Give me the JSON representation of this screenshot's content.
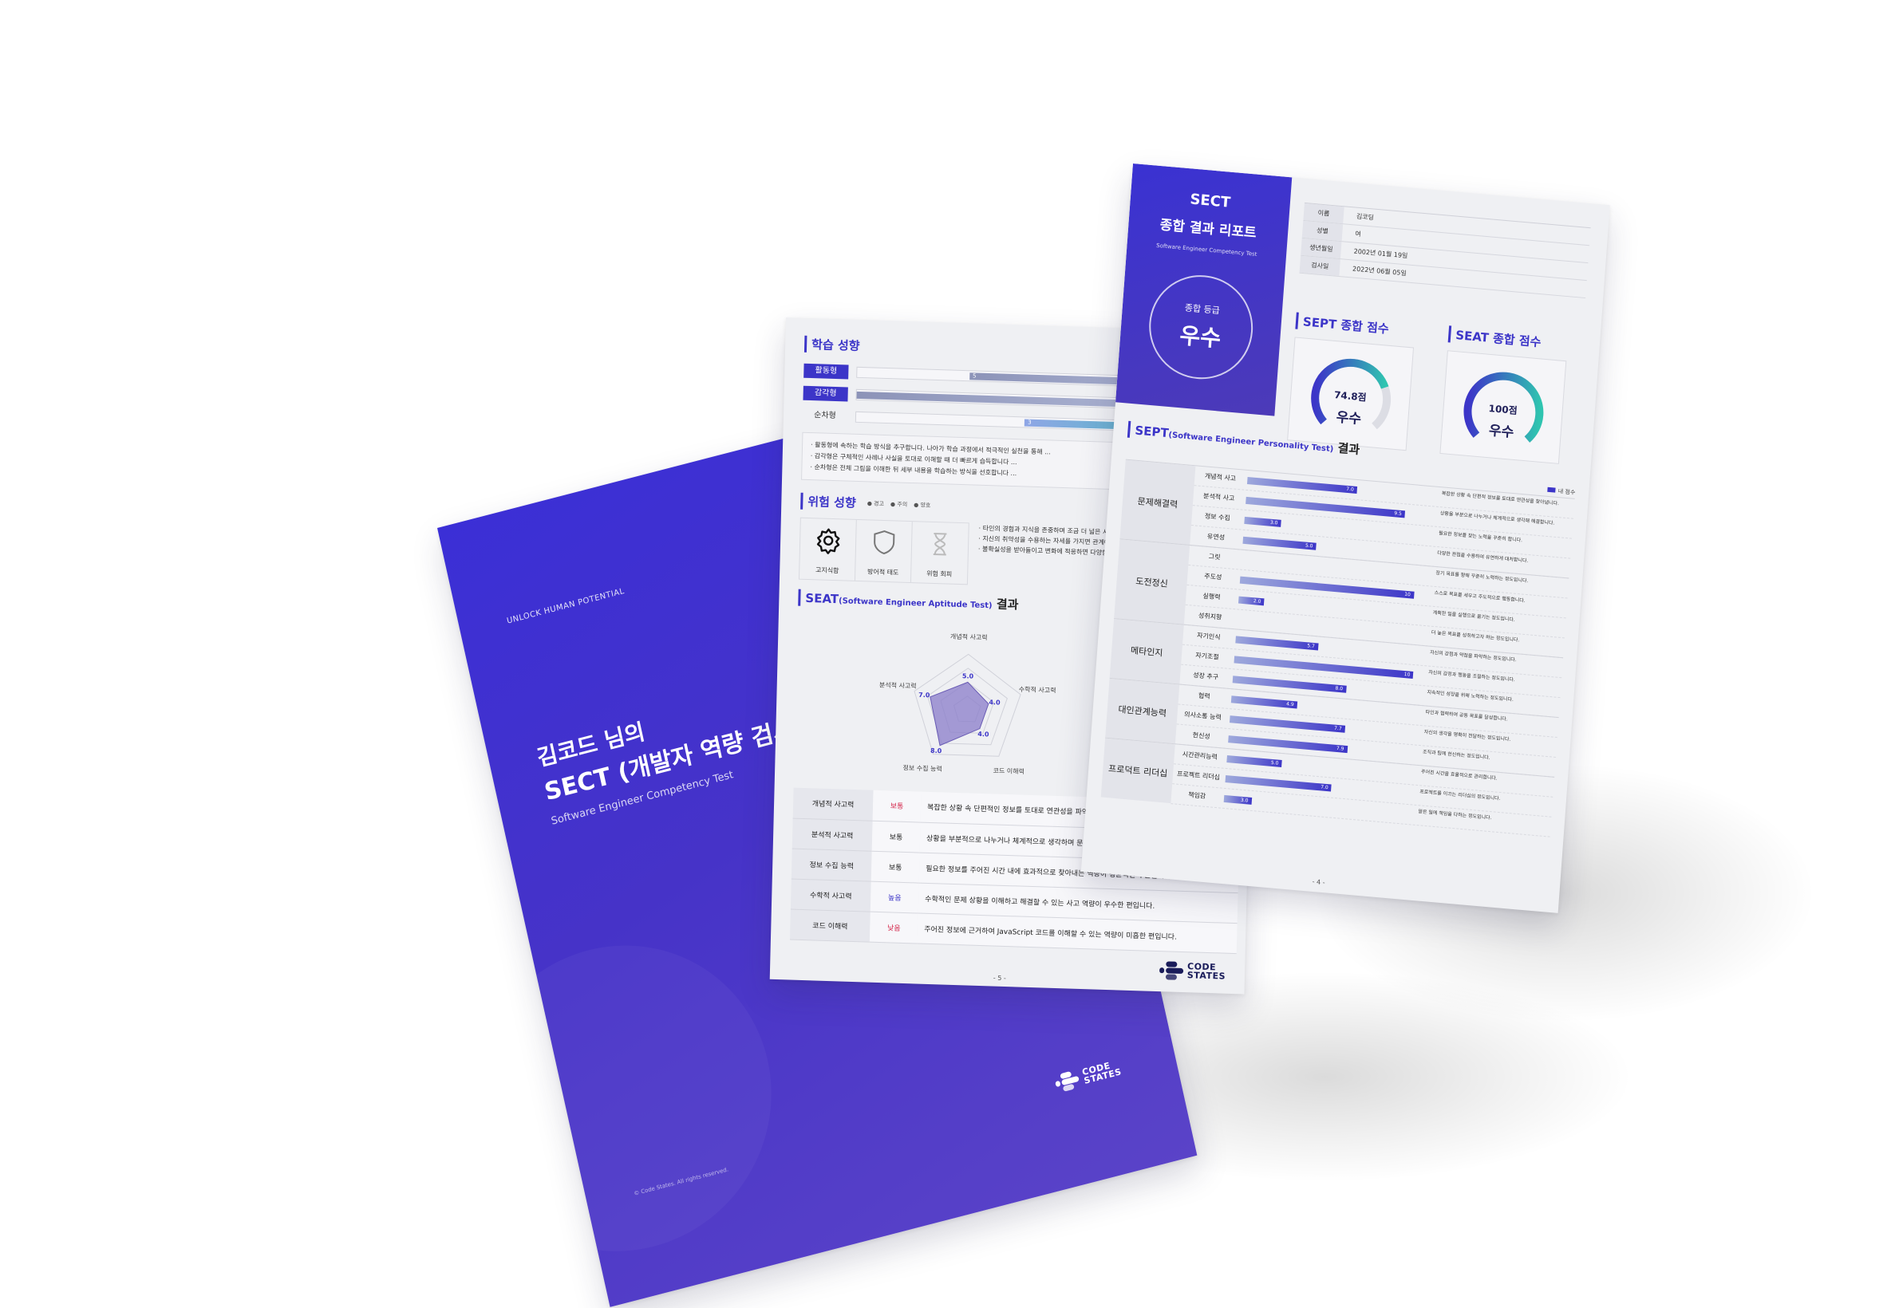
{
  "cover": {
    "tagline": "UNLOCK HUMAN POTENTIAL",
    "title_line1": "김코드 님의",
    "title_line2": "SECT (개발자 역량 검사) 결과 리",
    "subtitle": "Software Engineer Competency Test",
    "copyright": "© Code States. All rights reserved.",
    "logo_line1": "CODE",
    "logo_line2": "STATES"
  },
  "learning": {
    "title": "학습 성향",
    "rows": [
      {
        "label": "활동형",
        "active": true,
        "start": 0.28,
        "end": 1.0,
        "value_text": "5"
      },
      {
        "label": "감각형",
        "active": true,
        "start": 0.0,
        "end": 1.0,
        "value_text": ""
      },
      {
        "label": "순차형",
        "active": false,
        "start": 0.42,
        "end": 1.0,
        "value_text": "3"
      }
    ],
    "notes": [
      "· 활동형에 속하는 학습 방식을 추구합니다. 나아가 학습 과정에서 적극적인 실천을 통해 ...",
      "· 감각형은 구체적인 사례나 사실을 토대로 이해할 때 더 빠르게 습득합니다 ...",
      "· 순차형은 전체 그림을 이해한 뒤 세부 내용을 학습하는 방식을 선호합니다 ..."
    ]
  },
  "risk": {
    "title": "위험 성향",
    "legend": [
      "● 경고",
      "● 주의",
      "● 양호"
    ],
    "boxes": [
      {
        "label": "고지식함",
        "icon": "gear-icon"
      },
      {
        "label": "방어적 태도",
        "icon": "shield-icon"
      },
      {
        "label": "위험 회피",
        "icon": "hourglass-icon"
      }
    ],
    "desc": [
      "· 타인의 경험과 지식을 존중하며 조금 더 넓은 시야를 가질 수 있습니다.",
      "· 지신의 취약성을 수용하는 자세를 가지면 관계에 성숙한 태도를 보입니다.",
      "· 불확실성을 받아들이고 변화에 적응하면 다양한 경험을 할 수 있습니다."
    ]
  },
  "seat": {
    "title_main": "SEAT",
    "title_sub": "(Software Engineer Aptitude Test)",
    "title_tail": "결과",
    "rows": [
      {
        "name": "개념적 사고력",
        "level": "보통",
        "tone": "lo",
        "desc": "복잡한 상황 속 단편적인 정보를 토대로 연관성을 파악할 수 있습니다."
      },
      {
        "name": "분석적 사고력",
        "level": "보통",
        "tone": "",
        "desc": "상황을 부분적으로 나누거나 체계적으로 생각하며 문제를 해결합니다."
      },
      {
        "name": "정보 수집 능력",
        "level": "보통",
        "tone": "",
        "desc": "필요한 정보를 주어진 시간 내에 효과적으로 찾아내는 역량이 평균적인 수준입니다."
      },
      {
        "name": "수학적 사고력",
        "level": "높음",
        "tone": "hi",
        "desc": "수학적인 문제 상황을 이해하고 해결할 수 있는 사고 역량이 우수한 편입니다."
      },
      {
        "name": "코드 이해력",
        "level": "낮음",
        "tone": "lo",
        "desc": "주어진 정보에 근거하여 JavaScript 코드를 이해할 수 있는 역량이 미흡한 편입니다."
      }
    ],
    "page": "- 5 -"
  },
  "chart_data": {
    "type": "radar",
    "categories": [
      "개념적 사고력",
      "수학적 사고력",
      "코드 이해력",
      "정보 수집 능력",
      "분석적 사고력"
    ],
    "values": [
      5.0,
      4.0,
      4.0,
      8.0,
      7.0
    ],
    "value_labels": [
      "5.0",
      "4.0",
      "4.0",
      "8.0",
      "7.0"
    ],
    "ylim": [
      0,
      10
    ],
    "color": "#7c6fbd"
  },
  "report": {
    "hero_line1": "SECT",
    "hero_line2": "종합 결과 리포트",
    "hero_sub": "Software Engineer Competency Test",
    "grade_label": "종합 등급",
    "grade_value": "우수",
    "info": [
      {
        "k": "이름",
        "v": "김코딩"
      },
      {
        "k": "성별",
        "v": "여"
      },
      {
        "k": "생년월일",
        "v": "2002년 01월 19일"
      },
      {
        "k": "검사일",
        "v": "2022년 06월 05일"
      }
    ],
    "sept_score": {
      "title": "SEPT 종합 점수",
      "value": "74.8점",
      "grade": "우수",
      "fraction": 0.748
    },
    "seat_score": {
      "title": "SEAT 종합 점수",
      "value": "100점",
      "grade": "우수",
      "fraction": 1.0
    },
    "sept_title_main": "SEPT",
    "sept_title_sub": "(Software Engineer Personality Test)",
    "sept_title_tail": "결과",
    "legend": "내 점수",
    "groups": [
      {
        "name": "문제해결력",
        "items": [
          {
            "label": "개념적 사고",
            "score": 0.6,
            "text": "7.0",
            "desc": "복잡한 상황 속 단편적 정보를 토대로 연관성을 찾아냅니다."
          },
          {
            "label": "분석적 사고",
            "score": 0.87,
            "text": "9.5",
            "desc": "상황을 부분으로 나누거나 체계적으로 생각해 해결합니다."
          },
          {
            "label": "정보 수집",
            "score": 0.2,
            "text": "3.0",
            "desc": "필요한 정보를 찾는 노력을 꾸준히 합니다."
          },
          {
            "label": "유연성",
            "score": 0.4,
            "text": "5.0",
            "desc": "다양한 관점을 수용하여 유연하게 대처합니다."
          }
        ]
      },
      {
        "name": "도전정신",
        "items": [
          {
            "label": "그릿",
            "score": 0.0,
            "text": "",
            "desc": "장기 목표를 향해 꾸준히 노력하는 정도입니다."
          },
          {
            "label": "주도성",
            "score": 0.95,
            "text": "10",
            "desc": "스스로 목표를 세우고 주도적으로 행동합니다."
          },
          {
            "label": "실행력",
            "score": 0.14,
            "text": "2.0",
            "desc": "계획한 일을 실행으로 옮기는 정도입니다."
          },
          {
            "label": "성취지향",
            "score": 0.0,
            "text": "",
            "desc": "더 높은 목표를 성취하고자 하는 정도입니다."
          }
        ]
      },
      {
        "name": "메타인지",
        "items": [
          {
            "label": "자기인식",
            "score": 0.45,
            "text": "5.7",
            "desc": "자신의 강점과 약점을 파악하는 정도입니다."
          },
          {
            "label": "자기조절",
            "score": 0.98,
            "text": "10",
            "desc": "자신의 감정과 행동을 조절하는 정도입니다."
          },
          {
            "label": "성장 추구",
            "score": 0.62,
            "text": "8.0",
            "desc": "지속적인 성장을 위해 노력하는 정도입니다."
          }
        ]
      },
      {
        "name": "대인관계능력",
        "items": [
          {
            "label": "협력",
            "score": 0.36,
            "text": "4.9",
            "desc": "타인과 협력하여 공동 목표를 달성합니다."
          },
          {
            "label": "의사소통 능력",
            "score": 0.63,
            "text": "7.7",
            "desc": "자신의 생각을 명확히 전달하는 정도입니다."
          },
          {
            "label": "헌신성",
            "score": 0.65,
            "text": "7.9",
            "desc": "조직과 팀에 헌신하는 정도입니다."
          }
        ]
      },
      {
        "name": "프로덕트 리더십",
        "items": [
          {
            "label": "시간관리능력",
            "score": 0.3,
            "text": "5.0",
            "desc": "주어진 시간을 효율적으로 관리합니다."
          },
          {
            "label": "프로젝트 리더십",
            "score": 0.58,
            "text": "7.0",
            "desc": "프로젝트를 이끄는 리더십의 정도입니다."
          },
          {
            "label": "책임감",
            "score": 0.15,
            "text": "3.0",
            "desc": "맡은 일에 책임을 다하는 정도입니다."
          }
        ]
      }
    ],
    "page": "- 4 -"
  },
  "mid_logo_line1": "CODE",
  "mid_logo_line2": "STATES",
  "colors": {
    "brand": "#3c35c8",
    "accent_teal": "#2fc4b0",
    "low": "#d4264a"
  }
}
